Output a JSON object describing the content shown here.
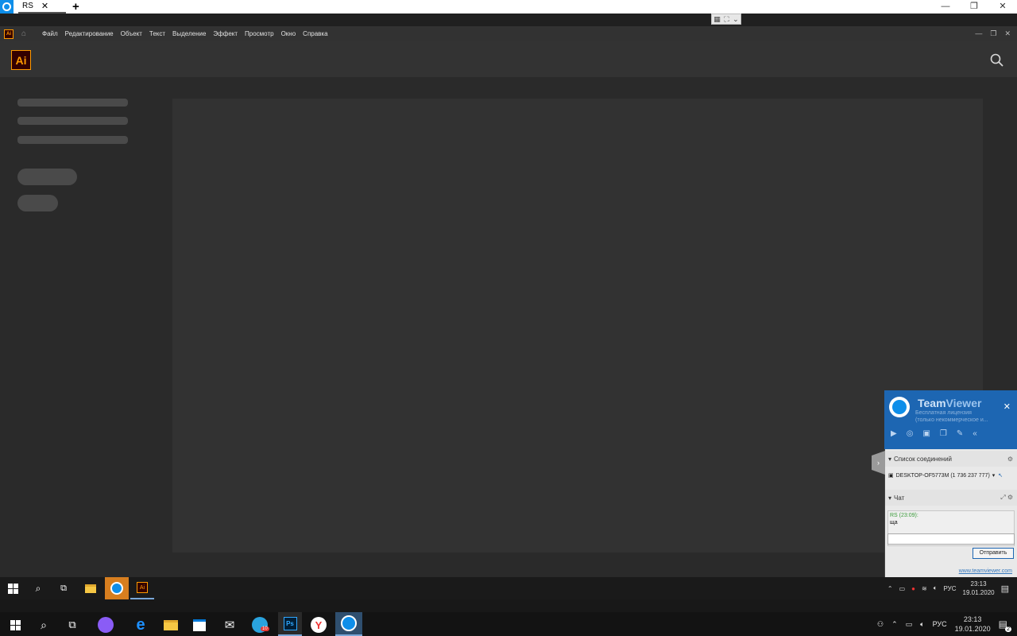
{
  "tv_tabbar": {
    "tab_label": "RS",
    "tab_close": "✕",
    "new_tab": "+",
    "minimize": "—",
    "restore": "❐",
    "close": "✕"
  },
  "illustrator": {
    "app_icon_text": "Ai",
    "menus": [
      "Файл",
      "Редактирование",
      "Объект",
      "Текст",
      "Выделение",
      "Эффект",
      "Просмотр",
      "Окно",
      "Справка"
    ],
    "window_controls": [
      "—",
      "❐",
      "✕"
    ]
  },
  "teamviewer_panel": {
    "brand_prefix": "Team",
    "brand_suffix": "Viewer",
    "license_line1": "Бесплатная лицензия",
    "license_line2": "(только некоммерческое и...",
    "close": "✕",
    "connections_header": "Список соединений",
    "connection_entry": "DESKTOP-OF5773M (1 736 237 777)",
    "chat_header": "Чат",
    "chat_sender": "RS (23:09):",
    "chat_message": "ща",
    "send_label": "Отправить",
    "footer_link": "www.teamviewer.com"
  },
  "inner_taskbar": {
    "language": "РУС",
    "time": "23:13",
    "date": "19.01.2020"
  },
  "outer_taskbar": {
    "telegram_badge": "10",
    "language": "РУС",
    "time": "23:13",
    "date": "19.01.2020",
    "notification_count": "2"
  }
}
